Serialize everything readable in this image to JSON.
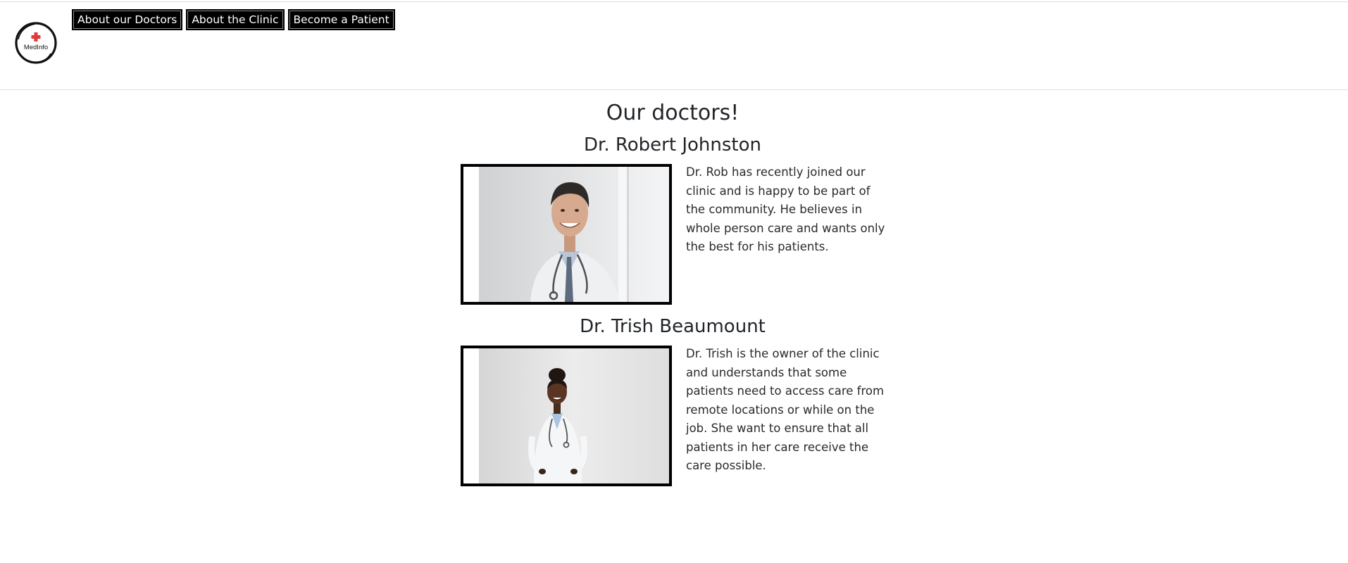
{
  "logo": {
    "text": "MedInfo",
    "icon": "red-cross-icon",
    "accent_color": "#e03a3a"
  },
  "nav": {
    "items": [
      {
        "label": "About our Doctors"
      },
      {
        "label": "About the Clinic"
      },
      {
        "label": "Become a Patient"
      }
    ]
  },
  "main": {
    "title": "Our doctors!",
    "doctors": [
      {
        "name": "Dr. Robert Johnston",
        "bio": "Dr. Rob has recently joined our clinic and is happy to be part of the community. He believes in whole person care and wants only the best for his patients.",
        "photo": "male-doctor-photo"
      },
      {
        "name": "Dr. Trish Beaumount",
        "bio": "Dr. Trish is the owner of the clinic and understands that some patients need to access care from remote locations or while on the job. She want to ensure that all patients in her care receive the care possible.",
        "photo": "female-doctor-photo"
      }
    ]
  }
}
